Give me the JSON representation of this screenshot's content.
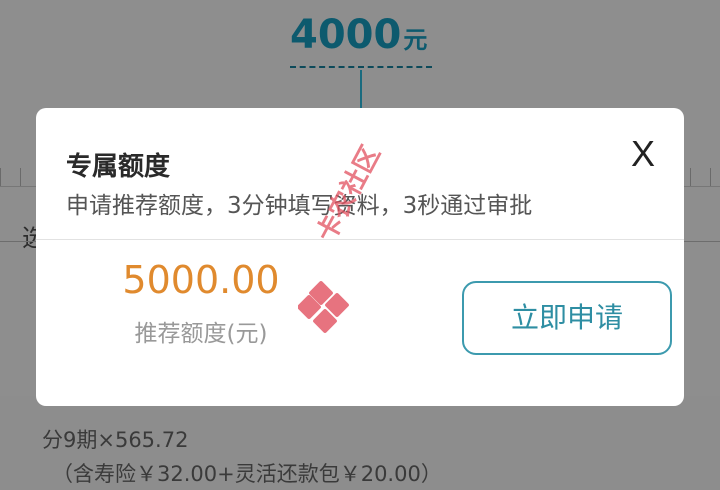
{
  "background": {
    "amount_value": "4000",
    "amount_unit": "元",
    "left_text": "选",
    "installment": "分9期×565.72",
    "insurance": "（含寿险￥32.00+灵活还款包￥20.00）"
  },
  "modal": {
    "title": "专属额度",
    "subtitle": "申请推荐额度，3分钟填写资料，3秒通过审批",
    "close_label": "X",
    "amount": "5000.00",
    "amount_label": "推荐额度(元)",
    "apply_label": "立即申请"
  },
  "watermark": {
    "text": "卡农社区"
  },
  "colors": {
    "accent": "#2e8ea3",
    "amount": "#e08a2e",
    "watermark": "#e1505f"
  }
}
